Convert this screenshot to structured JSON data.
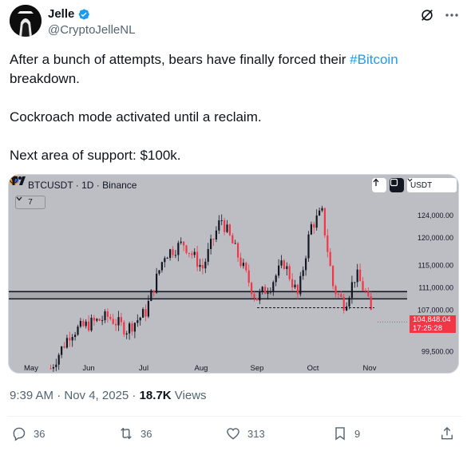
{
  "author": {
    "name": "Jelle",
    "handle": "@CryptoJelleNL"
  },
  "tweet": {
    "text_line1_a": "After a bunch of attempts, bears have finally forced their ",
    "hashtag": "#Bitcoin",
    "text_line1_b": " breakdown.",
    "paragraph2": "Cockroach mode activated until a reclaim.",
    "paragraph3": "Next area of support: $100k."
  },
  "chart": {
    "symbol_title": "BTCUSDT · 1D · Binance",
    "fold_label": "7",
    "currency": "USDT",
    "price_tag_value": "104,848.04",
    "price_tag_timer": "17:25:28",
    "y_ticks": [
      "124,000.00",
      "120,000.00",
      "115,000.00",
      "111,000.00",
      "107,000.00",
      "99,500.00"
    ],
    "x_ticks": [
      "May",
      "Jun",
      "Jul",
      "Aug",
      "Sep",
      "Oct",
      "Nov"
    ]
  },
  "chart_data": {
    "type": "candlestick",
    "title": "BTCUSDT · 1D · Binance",
    "x": [
      "May",
      "Jun",
      "Jul",
      "Aug",
      "Sep",
      "Oct",
      "Nov"
    ],
    "y_ticks": [
      124000,
      120000,
      115000,
      111000,
      107000,
      99500
    ],
    "ylim": [
      98000,
      127000
    ],
    "support_zone": [
      109000,
      110300
    ],
    "dashed_support_level": 107400,
    "last_price": 104848.04,
    "close_trend": [
      [
        "May",
        96500
      ],
      [
        "May",
        103000
      ],
      [
        "Jun",
        104500
      ],
      [
        "Jun",
        105800
      ],
      [
        "Jun",
        103500
      ],
      [
        "Jul",
        106500
      ],
      [
        "Jul",
        117000
      ],
      [
        "Jul",
        119000
      ],
      [
        "Aug",
        114500
      ],
      [
        "Aug",
        123500
      ],
      [
        "Aug",
        116000
      ],
      [
        "Sep",
        109000
      ],
      [
        "Sep",
        111500
      ],
      [
        "Sep",
        115500
      ],
      [
        "Sep",
        109500
      ],
      [
        "Oct",
        122000
      ],
      [
        "Oct",
        124500
      ],
      [
        "Oct",
        111000
      ],
      [
        "Oct",
        108000
      ],
      [
        "Oct",
        113500
      ],
      [
        "Nov",
        110000
      ],
      [
        "Nov",
        104848
      ]
    ],
    "colors": {
      "up": "#131722",
      "down": "#f23645",
      "background": "#bcbec4"
    }
  },
  "meta": {
    "time": "9:39 AM · Nov 4, 2025 · ",
    "views_count": "18.7K",
    "views_label": " Views"
  },
  "actions": {
    "replies": "36",
    "reposts": "36",
    "likes": "313",
    "bookmarks": "9"
  }
}
